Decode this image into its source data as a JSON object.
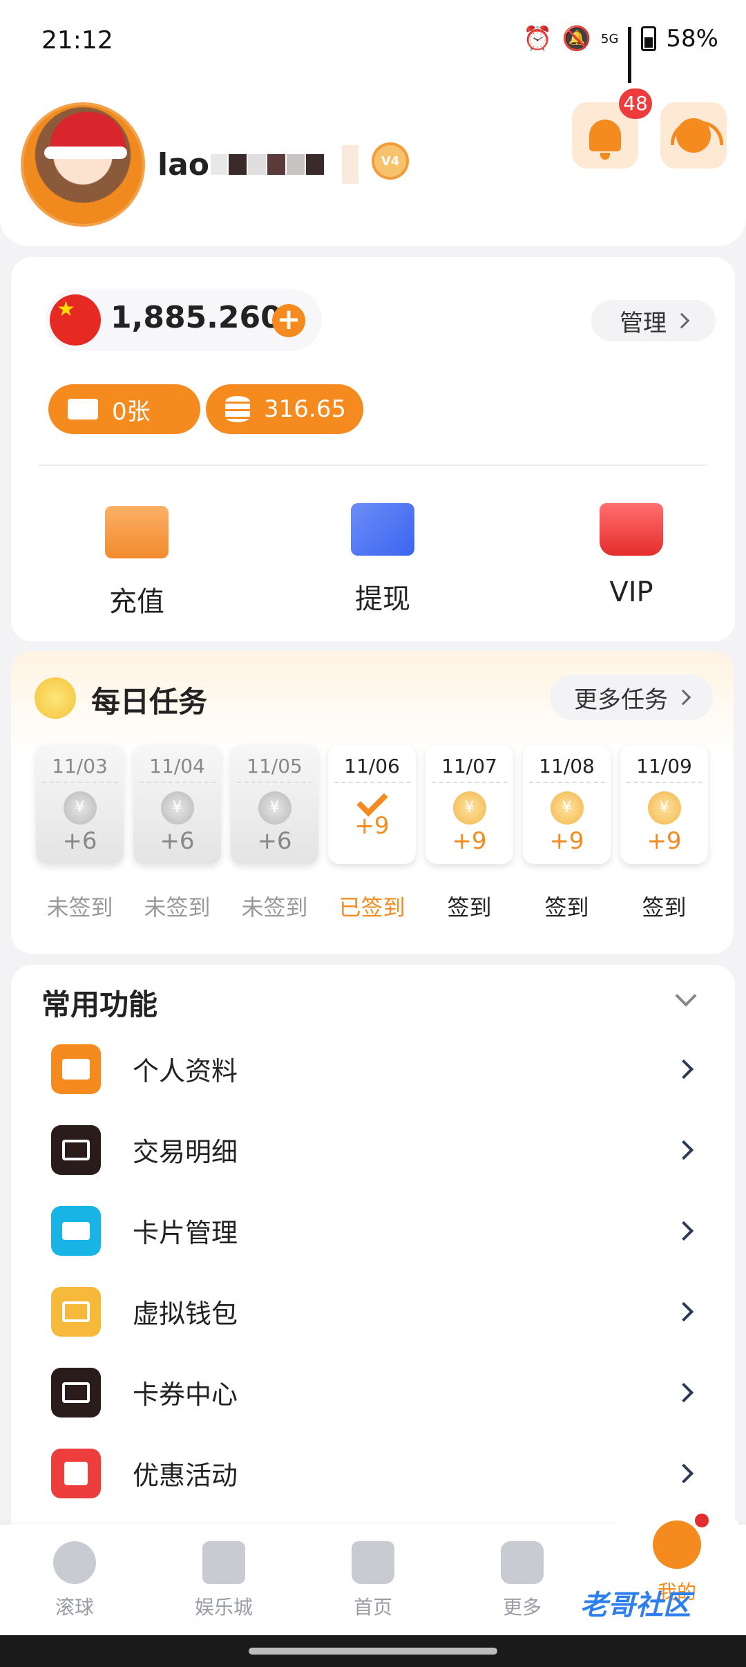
{
  "status_bar": {
    "time": "21:12",
    "network": "5G",
    "battery": "58%"
  },
  "profile": {
    "username": "lao",
    "vip_level": "V4",
    "notification_count": "48"
  },
  "wallet": {
    "balance": "1,885.260",
    "manage_label": "管理",
    "voucher": "0张",
    "coins": "316.65",
    "actions": [
      {
        "label": "充值",
        "icon": "wallet-icon"
      },
      {
        "label": "提现",
        "icon": "cards-icon"
      },
      {
        "label": "VIP",
        "icon": "crown-icon"
      }
    ]
  },
  "daily_tasks": {
    "title": "每日任务",
    "more_label": "更多任务",
    "days": [
      {
        "date": "11/03",
        "points": "+6",
        "status": "未签到",
        "state": "past"
      },
      {
        "date": "11/04",
        "points": "+6",
        "status": "未签到",
        "state": "past"
      },
      {
        "date": "11/05",
        "points": "+6",
        "status": "未签到",
        "state": "past"
      },
      {
        "date": "11/06",
        "points": "+9",
        "status": "已签到",
        "state": "done"
      },
      {
        "date": "11/07",
        "points": "+9",
        "status": "签到",
        "state": "future"
      },
      {
        "date": "11/08",
        "points": "+9",
        "status": "签到",
        "state": "future"
      },
      {
        "date": "11/09",
        "points": "+9",
        "status": "签到",
        "state": "future"
      }
    ]
  },
  "functions": {
    "title": "常用功能",
    "items": [
      {
        "label": "个人资料",
        "icon": "folder-icon",
        "color": "#f58a1f"
      },
      {
        "label": "交易明细",
        "icon": "document-icon",
        "color": "#2b1c1c"
      },
      {
        "label": "卡片管理",
        "icon": "card-icon",
        "color": "#19b4e6"
      },
      {
        "label": "虚拟钱包",
        "icon": "wallet-icon",
        "color": "#f6b93a"
      },
      {
        "label": "卡券中心",
        "icon": "ticket-icon",
        "color": "#2b1c1c"
      },
      {
        "label": "优惠活动",
        "icon": "gift-icon",
        "color": "#ee3d3d"
      }
    ]
  },
  "bottom_nav": [
    {
      "label": "滚球",
      "icon": "soccer-ball-icon"
    },
    {
      "label": "娱乐城",
      "icon": "cards-icon"
    },
    {
      "label": "首页",
      "icon": "home-icon"
    },
    {
      "label": "更多",
      "icon": "grid-icon"
    },
    {
      "label": "我的",
      "icon": "user-icon"
    }
  ],
  "watermark": "老哥社区"
}
